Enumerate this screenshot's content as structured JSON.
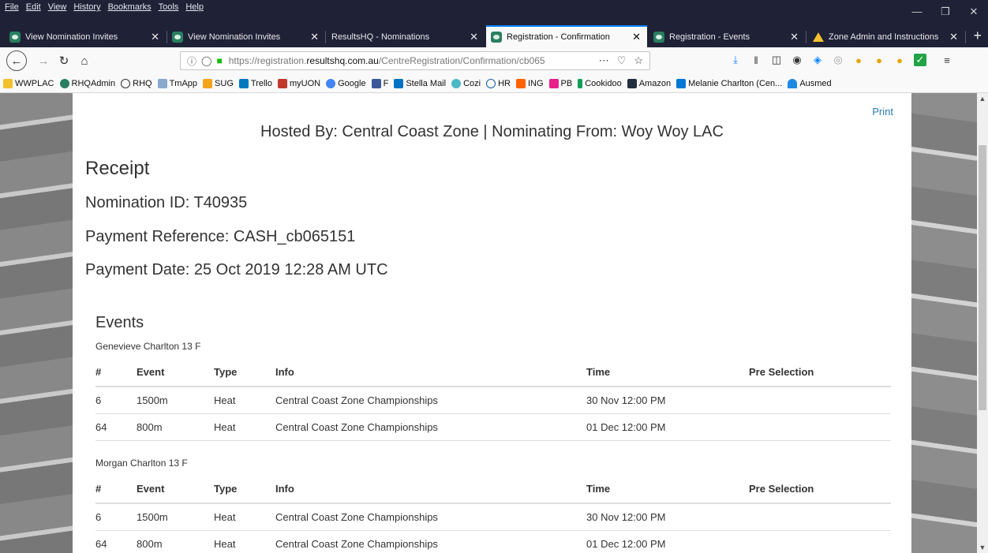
{
  "menu": [
    "File",
    "Edit",
    "View",
    "History",
    "Bookmarks",
    "Tools",
    "Help"
  ],
  "window_controls": [
    "minimize",
    "restore",
    "close"
  ],
  "tabs": [
    {
      "label": "View Nomination Invites",
      "active": false
    },
    {
      "label": "View Nomination Invites",
      "active": false
    },
    {
      "label": "ResultsHQ - Nominations",
      "active": false
    },
    {
      "label": "Registration - Confirmation",
      "active": true
    },
    {
      "label": "Registration - Events",
      "active": false
    },
    {
      "label": "Zone Admin and Instructions",
      "active": false
    }
  ],
  "url": {
    "prefix": "https://registration.",
    "domain": "resultshq.com.au",
    "path": "/CentreRegistration/Confirmation/cb065"
  },
  "bookmarks": [
    "WWPLAC",
    "RHQAdmin",
    "RHQ",
    "TmApp",
    "SUG",
    "Trello",
    "myUON",
    "Google",
    "F",
    "Stella Mail",
    "Cozi",
    "HR",
    "ING",
    "PB",
    "Cookidoo",
    "Amazon",
    "Melanie Charlton (Cen...",
    "Ausmed"
  ],
  "page": {
    "print": "Print",
    "hosted": "Hosted By: Central Coast Zone | Nominating From: Woy Woy LAC",
    "receipt": "Receipt",
    "nomination_id": "Nomination ID: T40935",
    "payment_ref": "Payment Reference: CASH_cb065151",
    "payment_date": "Payment Date: 25 Oct 2019 12:28 AM UTC",
    "events_title": "Events",
    "columns": [
      "#",
      "Event",
      "Type",
      "Info",
      "Time",
      "Pre Selection"
    ],
    "participants": [
      {
        "name": "Genevieve Charlton 13 F",
        "rows": [
          [
            "6",
            "1500m",
            "Heat",
            "Central Coast Zone Championships",
            "30 Nov 12:00 PM",
            ""
          ],
          [
            "64",
            "800m",
            "Heat",
            "Central Coast Zone Championships",
            "01 Dec 12:00 PM",
            ""
          ]
        ]
      },
      {
        "name": "Morgan Charlton 13 F",
        "rows": [
          [
            "6",
            "1500m",
            "Heat",
            "Central Coast Zone Championships",
            "30 Nov 12:00 PM",
            ""
          ],
          [
            "64",
            "800m",
            "Heat",
            "Central Coast Zone Championships",
            "01 Dec 12:00 PM",
            ""
          ]
        ]
      }
    ]
  }
}
